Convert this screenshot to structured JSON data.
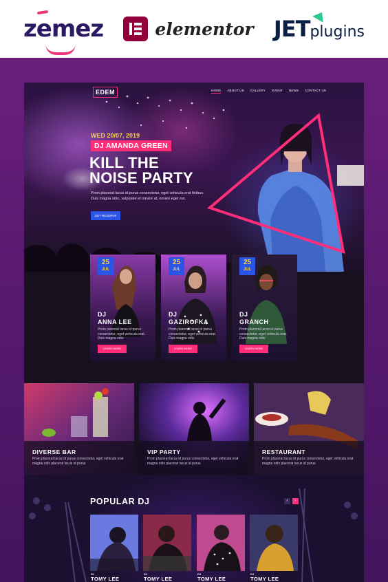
{
  "brands": {
    "zemez": "zemez",
    "elementor": "elementor",
    "jet": "JET",
    "plugins": "plugins"
  },
  "nav": {
    "logo": "EDEM",
    "items": [
      "HOME",
      "ABOUT US",
      "GALLERY",
      "EVENT",
      "NEWS",
      "CONTACT US"
    ]
  },
  "hero": {
    "date": "WED 20/07, 2019",
    "dj": "DJ AMANDA GREEN",
    "title_line1": "KILL THE",
    "title_line2": "NOISE PARTY",
    "text": "Proin placerat lacus id purus consectetur, eget vehicula erat finibus. Duis magna odio, vulputate et ornare at, ornare eget est.",
    "button": "GET RESERVE"
  },
  "cards": [
    {
      "day": "25",
      "month": "JUL",
      "name_line1": "DJ",
      "name_line2": "ANNA LEE",
      "text": "Proin placerat lacus id purus consectetur, eget vehicula erat. Duis magna odio",
      "button": "LEARN MORE"
    },
    {
      "day": "25",
      "month": "JUL",
      "name_line1": "DJ",
      "name_line2": "GAZIROFKA",
      "text": "Proin placerat lacus id purus consectetur, eget vehicula erat. Duis magna odio",
      "button": "LEARN MORE"
    },
    {
      "day": "25",
      "month": "JUL",
      "name_line1": "DJ",
      "name_line2": "GRANCH",
      "text": "Proin placerat lacus id purus consectetur, eget vehicula erat. Duis magna odio",
      "button": "LEARN MORE"
    }
  ],
  "venues": [
    {
      "title": "DIVERSE BAR",
      "text": "Proin placerat lacus id purus consectetur, eget vehicula erat magna odio placerat lacus id purus"
    },
    {
      "title": "VIP PARTY",
      "text": "Proin placerat lacus id purus consectetur, eget vehicula erat magna odio placerat lacus id purus"
    },
    {
      "title": "RESTAURANT",
      "text": "Proin placerat lacus id purus consectetur, eget vehicula erat magna odio placerat lacus id purus"
    }
  ],
  "popular": {
    "title": "POPULAR DJ",
    "prev": "‹",
    "next": "›",
    "djs": [
      {
        "prefix": "DJ",
        "name": "TOMY LEE"
      },
      {
        "prefix": "DJ",
        "name": "TOMY LEE"
      },
      {
        "prefix": "DJ",
        "name": "TOMY LEE"
      },
      {
        "prefix": "DJ",
        "name": "TOMY LEE"
      }
    ]
  },
  "colors": {
    "accent_pink": "#ff2e78",
    "accent_blue": "#2a55e6",
    "accent_yellow": "#ffd23f",
    "page_purple": "#6b1f7a"
  }
}
